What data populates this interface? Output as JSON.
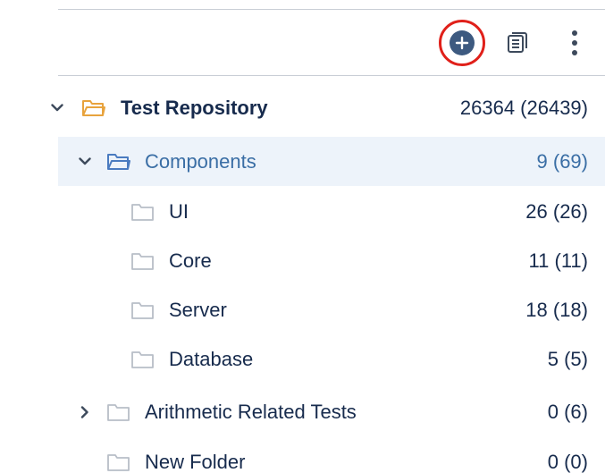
{
  "colors": {
    "highlight": "#e0201a",
    "add_button": "#3d5a80",
    "selected_row_bg": "#edf3fa",
    "selected_text": "#3a6ea5",
    "root_folder": "#e8a33d",
    "open_folder": "#4a7bc0",
    "closed_folder": "#b8bec7"
  },
  "toolbar": {
    "add_icon": "plus-circle-icon",
    "document_icon": "document-list-icon",
    "more_icon": "vertical-dots-icon"
  },
  "tree": {
    "root": {
      "label": "Test Repository",
      "count": "26364 (26439)"
    },
    "components": {
      "label": "Components",
      "count": "9 (69)"
    },
    "children": [
      {
        "label": "UI",
        "count": "26 (26)"
      },
      {
        "label": "Core",
        "count": "11 (11)"
      },
      {
        "label": "Server",
        "count": "18 (18)"
      },
      {
        "label": "Database",
        "count": "5 (5)"
      }
    ],
    "arithmetic": {
      "label": "Arithmetic Related Tests",
      "count": "0 (6)"
    },
    "new_folder": {
      "label": "New Folder",
      "count": "0 (0)"
    }
  }
}
